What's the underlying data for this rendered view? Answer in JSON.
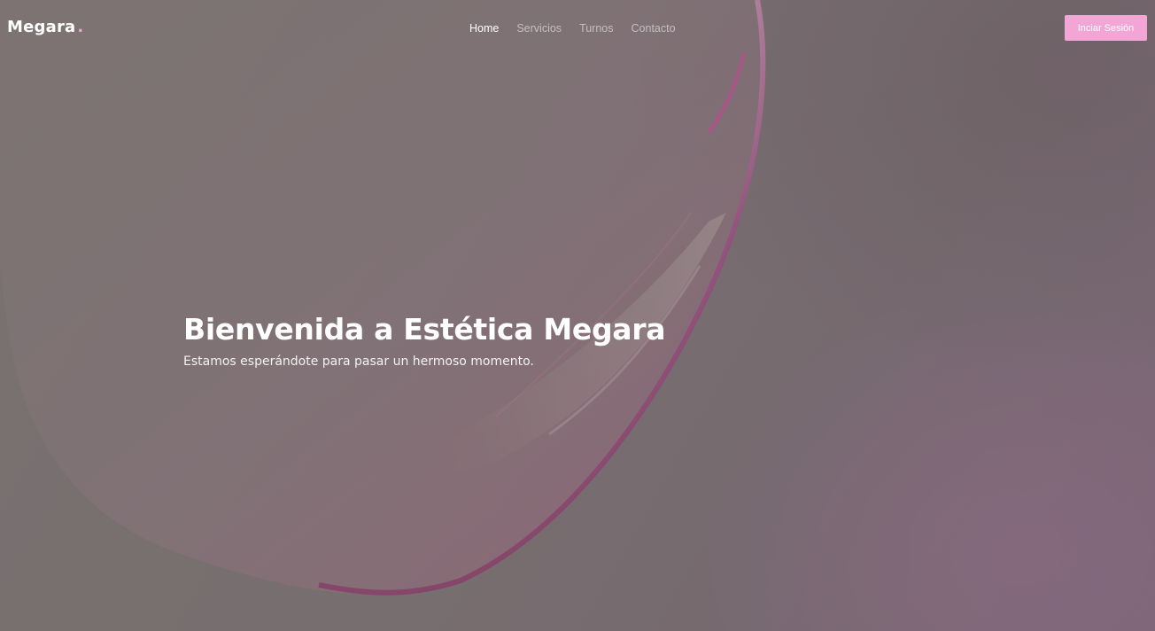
{
  "brand": {
    "name": "Megara",
    "dot": ".",
    "accent_color": "#e8a9cf"
  },
  "nav": {
    "items": [
      {
        "label": "Home",
        "active": true
      },
      {
        "label": "Servicios",
        "active": false
      },
      {
        "label": "Turnos",
        "active": false
      },
      {
        "label": "Contacto",
        "active": false
      }
    ]
  },
  "login_button": {
    "label": "Inciar Sesión",
    "color": "#f2a6d6"
  },
  "hero": {
    "title": "Bienvenida a Estética Megara",
    "subtitle": "Estamos esperándote para pasar un hermoso momento."
  }
}
